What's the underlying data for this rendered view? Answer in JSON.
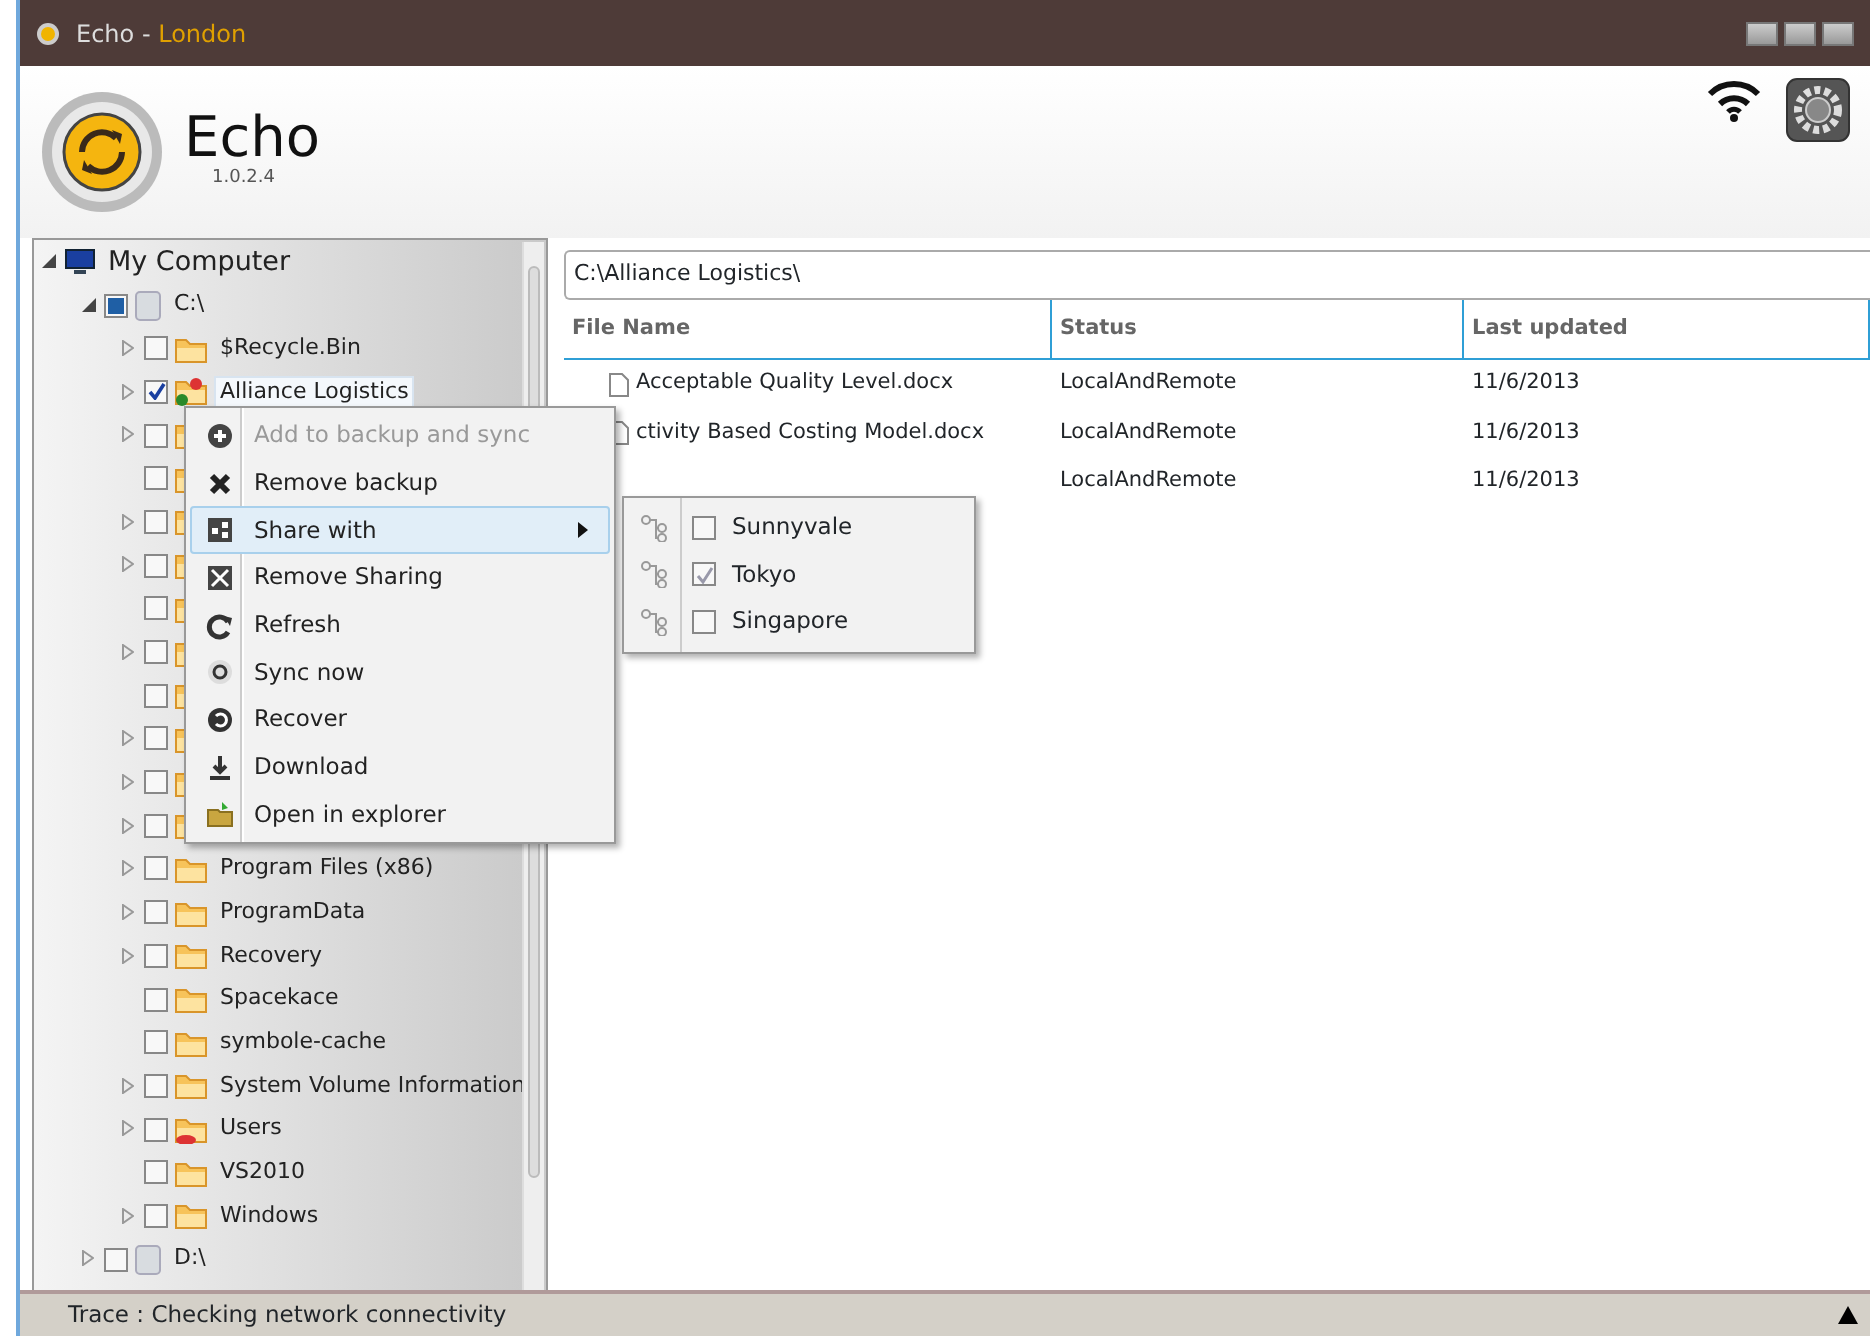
{
  "window": {
    "title": "Echo - ",
    "location": "London"
  },
  "app": {
    "name": "Echo",
    "version": "1.0.2.4"
  },
  "tree": [
    {
      "label": "My Computer",
      "kind": "computer",
      "expanded": true,
      "children": [
        {
          "label": "C:\\",
          "kind": "drive",
          "expanded": true,
          "checked": false,
          "indeterminate": true,
          "children": [
            {
              "label": "$Recycle.Bin",
              "kind": "folder",
              "expandable": true,
              "checked": false,
              "selected": false
            },
            {
              "label": "Alliance Logistics",
              "kind": "synced",
              "expandable": true,
              "checked": true,
              "selected": true
            },
            {
              "kind": "folder",
              "expandable": true,
              "checked": false,
              "selected": false
            },
            {
              "kind": "folder",
              "expandable": false,
              "checked": false,
              "selected": false
            },
            {
              "kind": "folder",
              "expandable": true,
              "checked": false,
              "selected": false
            },
            {
              "kind": "folder",
              "expandable": true,
              "checked": false,
              "selected": false
            },
            {
              "kind": "folder",
              "expandable": false,
              "checked": false,
              "selected": false
            },
            {
              "kind": "folder",
              "expandable": true,
              "checked": false,
              "selected": false
            },
            {
              "kind": "folder",
              "expandable": false,
              "checked": false,
              "selected": false
            },
            {
              "kind": "folder",
              "expandable": true,
              "checked": false,
              "selected": false
            },
            {
              "kind": "folder",
              "expandable": true,
              "checked": false,
              "selected": false
            },
            {
              "kind": "folder",
              "expandable": true,
              "checked": false,
              "selected": false
            },
            {
              "label": "Program Files (x86)",
              "kind": "folder",
              "expandable": true,
              "checked": false,
              "selected": false
            },
            {
              "label": "ProgramData",
              "kind": "folder",
              "expandable": true,
              "checked": false,
              "selected": false
            },
            {
              "label": "Recovery",
              "kind": "folder",
              "expandable": true,
              "checked": false,
              "selected": false
            },
            {
              "label": "Spacekace",
              "kind": "folder",
              "expandable": false,
              "checked": false,
              "selected": false
            },
            {
              "label": "symbole-cache",
              "kind": "folder",
              "expandable": false,
              "checked": false,
              "selected": false
            },
            {
              "label": "System Volume Information",
              "kind": "folder",
              "expandable": true,
              "checked": false,
              "selected": false
            },
            {
              "label": "Users",
              "kind": "user",
              "expandable": true,
              "checked": false,
              "selected": false
            },
            {
              "label": "VS2010",
              "kind": "folder",
              "expandable": false,
              "checked": false,
              "selected": false
            },
            {
              "label": "Windows",
              "kind": "folder",
              "expandable": true,
              "checked": false,
              "selected": false
            }
          ]
        },
        {
          "label": "D:\\",
          "kind": "drive",
          "expanded": false,
          "checked": false,
          "indeterminate": false
        }
      ]
    }
  ],
  "path": "C:\\Alliance Logistics\\",
  "table": {
    "columns": [
      "File Name",
      "Status",
      "Last updated"
    ],
    "rows": [
      {
        "file": "Acceptable Quality Level.docx",
        "status": "LocalAndRemote",
        "updated": "11/6/2013"
      },
      {
        "file": "ctivity Based Costing Model.docx",
        "status": "LocalAndRemote",
        "updated": "11/6/2013"
      },
      {
        "status": "LocalAndRemote",
        "updated": "11/6/2013"
      }
    ]
  },
  "context_menu": [
    {
      "label": "Add to backup and sync",
      "disabled": true,
      "selected": false
    },
    {
      "label": "Remove backup",
      "disabled": false,
      "selected": false
    },
    {
      "label": "Share with",
      "disabled": false,
      "selected": true,
      "submenu": true
    },
    {
      "label": "Remove Sharing",
      "disabled": false,
      "selected": false
    },
    {
      "label": "Refresh",
      "disabled": false,
      "selected": false
    },
    {
      "label": "Sync now",
      "disabled": false,
      "selected": false
    },
    {
      "label": "Recover",
      "disabled": false,
      "selected": false
    },
    {
      "label": "Download",
      "disabled": false,
      "selected": false
    },
    {
      "label": "Open in explorer",
      "disabled": false,
      "selected": false
    }
  ],
  "share_submenu": [
    {
      "label": "Sunnyvale",
      "checked": false
    },
    {
      "label": "Tokyo",
      "checked": true
    },
    {
      "label": "Singapore",
      "checked": false
    }
  ],
  "status_bar": {
    "text": "Trace : Checking network connectivity"
  }
}
